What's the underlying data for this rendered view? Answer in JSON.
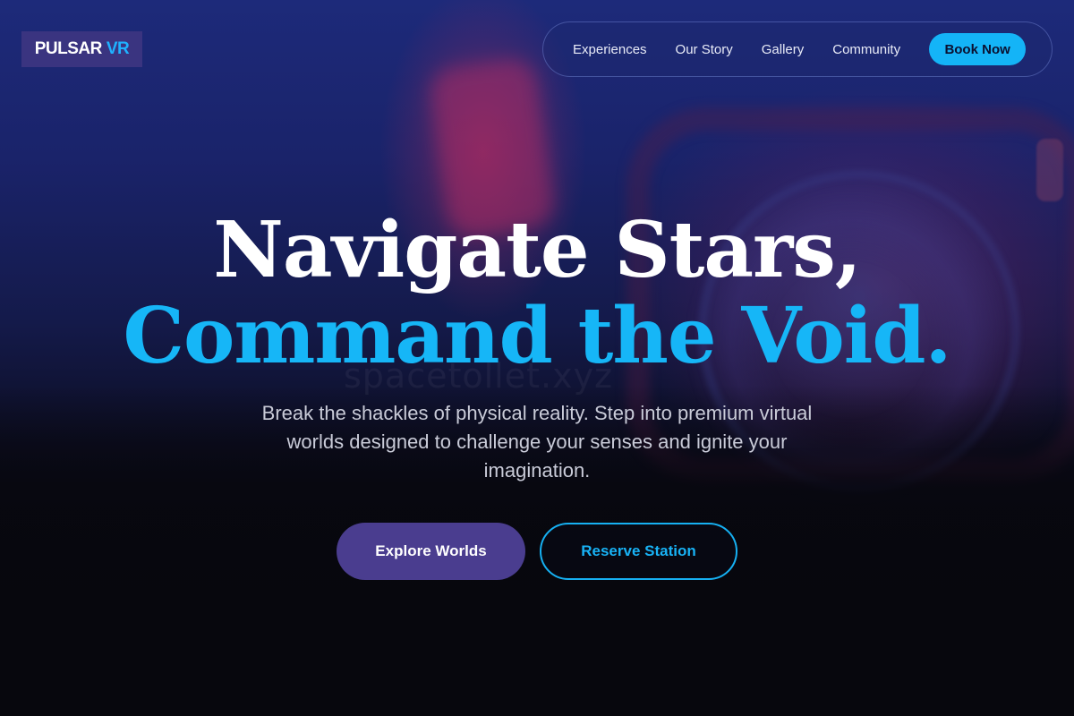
{
  "brand": {
    "name_part1": "PULSAR",
    "name_part2": "VR"
  },
  "nav": {
    "links": [
      "Experiences",
      "Our Story",
      "Gallery",
      "Community"
    ],
    "cta_label": "Book Now"
  },
  "hero": {
    "headline_line1": "Navigate Stars,",
    "headline_line2": "Command the Void.",
    "subtitle": "Break the shackles of physical reality. Step into premium virtual worlds designed to challenge your senses and ignite your imagination.",
    "primary_button": "Explore Worlds",
    "secondary_button": "Reserve Station"
  },
  "watermark": "spacetollet.xyz",
  "colors": {
    "accent": "#16b6f7",
    "primary_button": "#4a3d8f",
    "logo_bg": "#3a3480",
    "background": "#07070f"
  }
}
